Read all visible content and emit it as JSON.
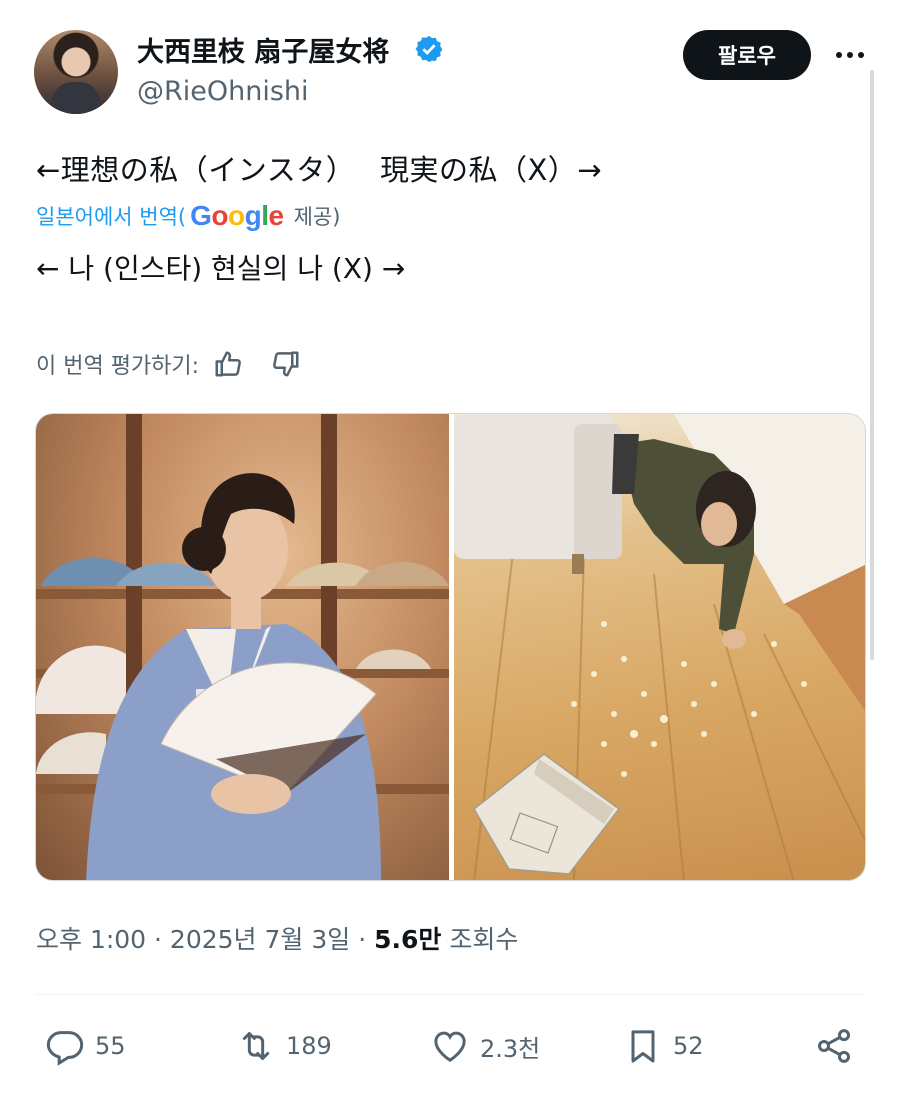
{
  "header": {
    "display_name": "大西里枝 扇子屋女将",
    "handle": "@RieOhnishi",
    "follow_label": "팔로우"
  },
  "tweet": {
    "text": "←理想の私（インスタ）　 現実の私（X）→",
    "translation_prefix": "일본어에서 번역(",
    "translation_provider": "Google",
    "translation_suffix": "제공)",
    "translated_text": "← 나 (인스타) 현실의 나 (X) →",
    "rate_label": "이 번역 평가하기:"
  },
  "meta": {
    "timestamp": "오후 1:00 · 2025년 7월 3일 · ",
    "views_count": "5.6만",
    "views_label": " 조회수"
  },
  "actions": {
    "replies": "55",
    "reposts": "189",
    "likes": "2.3천",
    "bookmarks": "52"
  },
  "colors": {
    "accent": "#1d9bf0",
    "text": "#0f1419",
    "muted": "#536471"
  },
  "icons": [
    "verified-badge-icon",
    "more-icon",
    "thumbs-up-icon",
    "thumbs-down-icon",
    "reply-icon",
    "repost-icon",
    "like-icon",
    "bookmark-icon",
    "share-icon"
  ]
}
